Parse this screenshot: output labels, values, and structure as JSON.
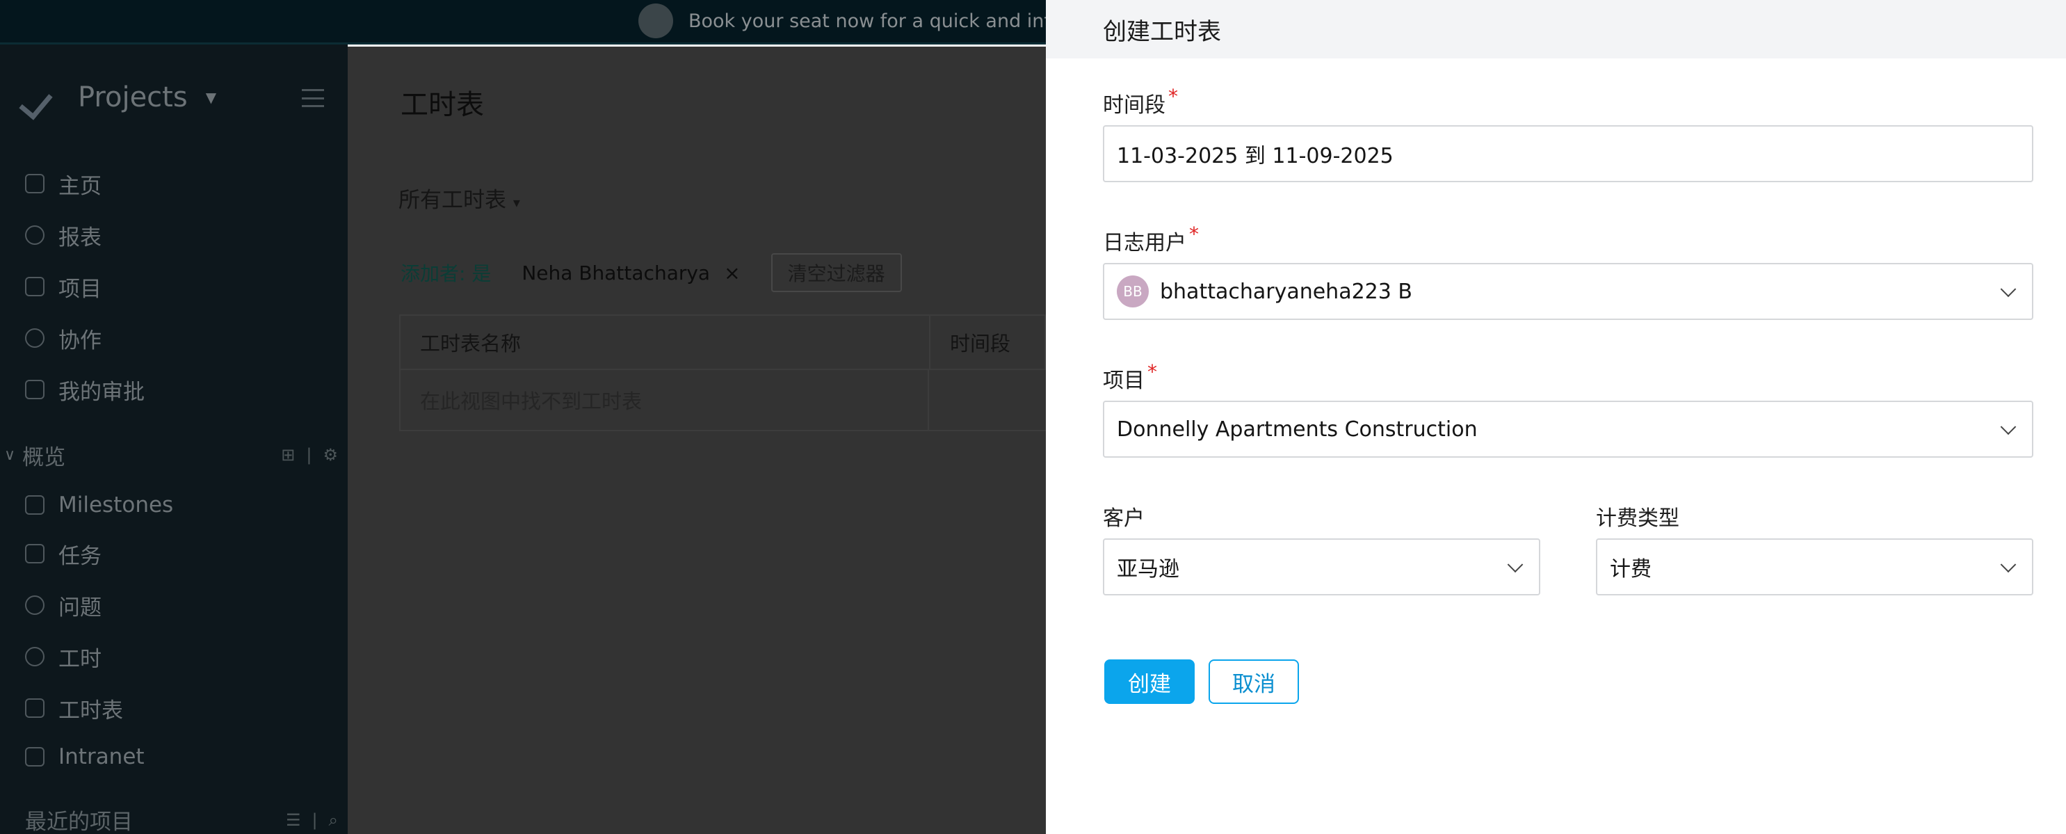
{
  "banner": {
    "text": "Book your seat now for a quick and info"
  },
  "sidebar": {
    "app_name": "Projects",
    "nav": [
      {
        "label": "主页",
        "icon": "home-icon"
      },
      {
        "label": "报表",
        "icon": "reports-icon"
      },
      {
        "label": "项目",
        "icon": "projects-icon"
      },
      {
        "label": "协作",
        "icon": "collaboration-icon"
      },
      {
        "label": "我的审批",
        "icon": "approvals-icon"
      }
    ],
    "section": {
      "label": "概览"
    },
    "overview": [
      {
        "label": "Milestones",
        "icon": "flag-icon"
      },
      {
        "label": "任务",
        "icon": "task-icon"
      },
      {
        "label": "问题",
        "icon": "bug-icon"
      },
      {
        "label": "工时",
        "icon": "timer-icon"
      },
      {
        "label": "工时表",
        "icon": "timesheet-icon"
      },
      {
        "label": "Intranet",
        "icon": "intranet-icon"
      }
    ],
    "recent_label": "最近的项目"
  },
  "main": {
    "title": "工时表",
    "view_select": "所有工时表",
    "filter": {
      "label": "添加者: 是",
      "chip": "Neha Bhattacharya",
      "clear": "清空过滤器"
    },
    "table": {
      "headers": [
        "工时表名称",
        "时间段"
      ],
      "empty_text": "在此视图中找不到工时表"
    }
  },
  "drawer": {
    "title": "创建工时表",
    "period": {
      "label": "时间段",
      "value": "11-03-2025 到 11-09-2025"
    },
    "user": {
      "label": "日志用户",
      "initials": "BB",
      "value": "bhattacharyaneha223 B"
    },
    "project": {
      "label": "项目",
      "value": "Donnelly Apartments Construction"
    },
    "client": {
      "label": "客户",
      "value": "亚马逊"
    },
    "billing": {
      "label": "计费类型",
      "value": "计费"
    },
    "required_mark": "*",
    "create_label": "创建",
    "cancel_label": "取消"
  }
}
